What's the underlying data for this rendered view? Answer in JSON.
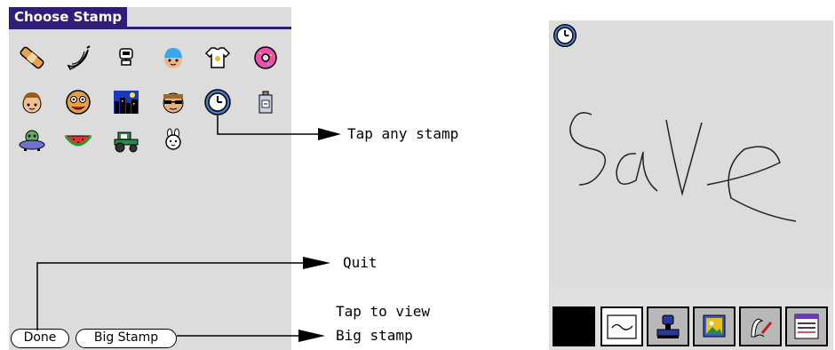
{
  "left_panel": {
    "title": "Choose Stamp",
    "stamps": [
      {
        "name": "bandage-stamp-icon"
      },
      {
        "name": "banana-stamp-icon"
      },
      {
        "name": "robot-head-stamp-icon"
      },
      {
        "name": "blue-hair-face-stamp-icon"
      },
      {
        "name": "tshirt-stamp-icon"
      },
      {
        "name": "donut-stamp-icon"
      },
      {
        "name": "boy-face-stamp-icon"
      },
      {
        "name": "goofy-face-stamp-icon"
      },
      {
        "name": "night-city-stamp-icon"
      },
      {
        "name": "sunglasses-face-stamp-icon"
      },
      {
        "name": "clock-stamp-icon"
      },
      {
        "name": "bottle-stamp-icon"
      },
      {
        "name": "ufo-alien-stamp-icon"
      },
      {
        "name": "watermelon-stamp-icon"
      },
      {
        "name": "tractor-stamp-icon"
      },
      {
        "name": "bunny-stamp-icon"
      }
    ],
    "done_label": "Done",
    "big_stamp_label": "Big Stamp"
  },
  "annotations": {
    "tap_stamp": "Tap any stamp",
    "quit": "Quit",
    "tap_to_view": "Tap to view",
    "big_stamp": "Big stamp"
  },
  "right_panel": {
    "toolbar_icons": [
      "black-color-swatch",
      "line-style-icon",
      "stamp-tool-icon",
      "picture-icon",
      "pen-tool-icon",
      "menu-list-icon"
    ]
  },
  "colors": {
    "title_bg": "#2f1d78",
    "screen_bg": "#dcdcdc"
  }
}
